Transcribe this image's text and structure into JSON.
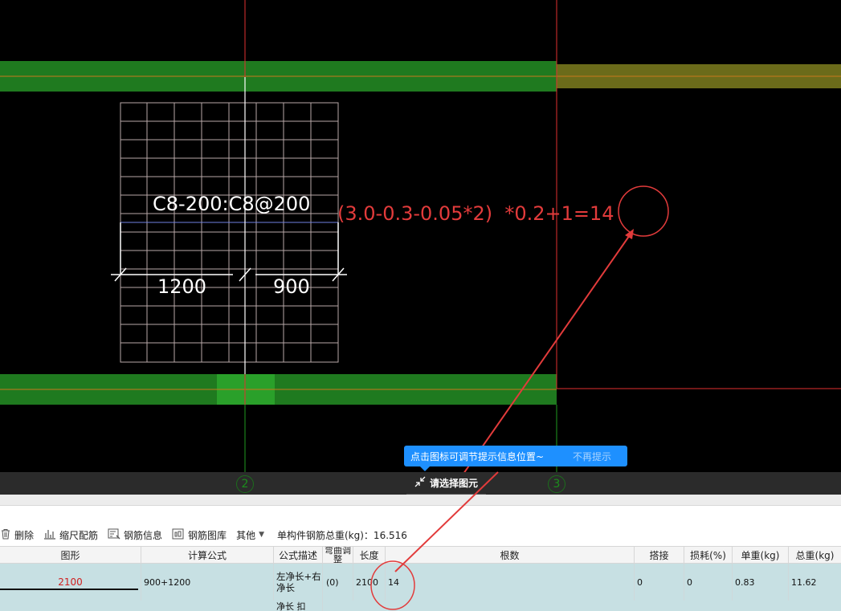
{
  "canvas": {
    "rebar_label": "C8-200:C8@200",
    "dim_left": "1200",
    "dim_right": "900",
    "formula_annotation": "(3.0-0.3-0.05*2)  *0.2+1=14",
    "axis_2": "2",
    "axis_3": "3",
    "colors": {
      "beam": "#1f7a1f",
      "beam_highlight": "#6b6b1a",
      "axis_red": "#e03030",
      "annotation": "#e23b3b"
    }
  },
  "tooltip": {
    "message": "点击图标可调节提示信息位置~",
    "dismiss": "不再提示"
  },
  "status": {
    "select_label": "请选择图元"
  },
  "toolbar": {
    "delete": "删除",
    "scale_rebar": "缩尺配筋",
    "rebar_info": "钢筋信息",
    "rebar_library": "钢筋图库",
    "other": "其他",
    "weight_label": "单构件钢筋总重(kg)：16.516"
  },
  "table": {
    "headers": [
      "图形",
      "计算公式",
      "公式描述",
      "弯曲调整",
      "长度",
      "根数",
      "搭接",
      "损耗(%)",
      "单重(kg)",
      "总重(kg)"
    ],
    "rows": [
      {
        "shape": "2100",
        "formula": "900+1200",
        "description": "左净长+右净长",
        "bend_adjust": "(0)",
        "length": "2100",
        "count": "14",
        "lap": "0",
        "loss": "0",
        "unit_weight": "0.83",
        "total_weight": "11.62"
      },
      {
        "description": "净长  扣"
      }
    ]
  }
}
